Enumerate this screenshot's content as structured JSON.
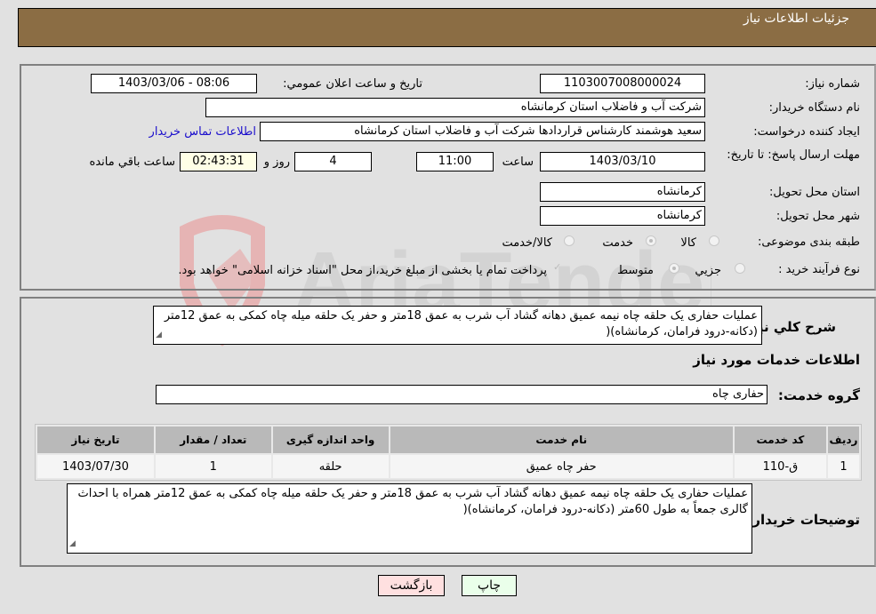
{
  "header": {
    "title": "جزئیات اطلاعات نیاز"
  },
  "form": {
    "need_number": {
      "label": "شماره نیاز:",
      "value": "1103007008000024"
    },
    "announce_datetime": {
      "label": "تاریخ و ساعت اعلان عمومي:",
      "value": "1403/03/06 - 08:06"
    },
    "buyer_org": {
      "label": "نام دستگاه خریدار:",
      "value": "شرکت آب و فاضلاب استان کرمانشاه"
    },
    "requester": {
      "label": "ایجاد کننده درخواست:",
      "value": "سعید هوشمند کارشناس قراردادها شرکت آب و فاضلاب استان کرمانشاه",
      "contact_link": "اطلاعات تماس خریدار"
    },
    "deadline": {
      "label": "مهلت ارسال پاسخ: تا تاریخ:",
      "date": "1403/03/10",
      "time_label": "ساعت",
      "time": "11:00",
      "days": "4",
      "days_label": "روز و",
      "remaining": "02:43:31",
      "remaining_label": "ساعت باقي مانده"
    },
    "delivery_province": {
      "label": "استان محل تحویل:",
      "value": "کرمانشاه"
    },
    "delivery_city": {
      "label": "شهر محل تحویل:",
      "value": "کرمانشاه"
    },
    "category": {
      "label": "طبقه بندی موضوعی:",
      "options": [
        "کالا",
        "خدمت",
        "کالا/خدمت"
      ],
      "selected": "خدمت"
    },
    "purchase_type": {
      "label": "نوع فرآیند خرید :",
      "options": [
        "جزيي",
        "متوسط"
      ],
      "selected": "متوسط",
      "treasury_note": "پرداخت تمام یا بخشی از مبلغ خرید،از محل \"اسناد خزانه اسلامی\" خواهد بود.",
      "treasury_checked": true
    }
  },
  "details": {
    "summary_label": "شرح كلي نياز:",
    "summary": "عملیات حفاری یک حلقه چاه نیمه عمیق دهانه گشاد آب شرب به عمق 18متر و حفر یک حلقه میله چاه کمکی به عمق 12متر (دکانه-درود فرامان، کرمانشاه)(",
    "services_heading": "اطلاعات خدمات مورد نیاز",
    "service_group_label": "گروه خدمت:",
    "service_group": "حفاری چاه",
    "table": {
      "headers": [
        "ردیف",
        "کد خدمت",
        "نام خدمت",
        "واحد اندازه گیری",
        "تعداد / مقدار",
        "تاریخ نیاز"
      ],
      "rows": [
        [
          "1",
          "ق-110",
          "حفر چاه عمیق",
          "حلقه",
          "1",
          "1403/07/30"
        ]
      ]
    },
    "buyer_notes_label": "توضیحات خریدار:",
    "buyer_notes": "عملیات حفاری یک حلقه چاه نیمه عمیق دهانه گشاد آب شرب به عمق 18متر و حفر یک حلقه میله چاه کمکی به عمق 12متر همراه با احداث گالری جمعاً به طول 60متر (دکانه-درود فرامان، کرمانشاه)("
  },
  "buttons": {
    "print": "چاپ",
    "back": "بازگشت"
  },
  "colors": {
    "header_bg": "#8b6d44",
    "remaining_bg": "#ffffe6",
    "print_bg": "#eaffea",
    "back_bg": "#ffe0e0",
    "link": "#1a0dcc"
  },
  "watermark": {
    "text": "AriaTender.neT"
  }
}
